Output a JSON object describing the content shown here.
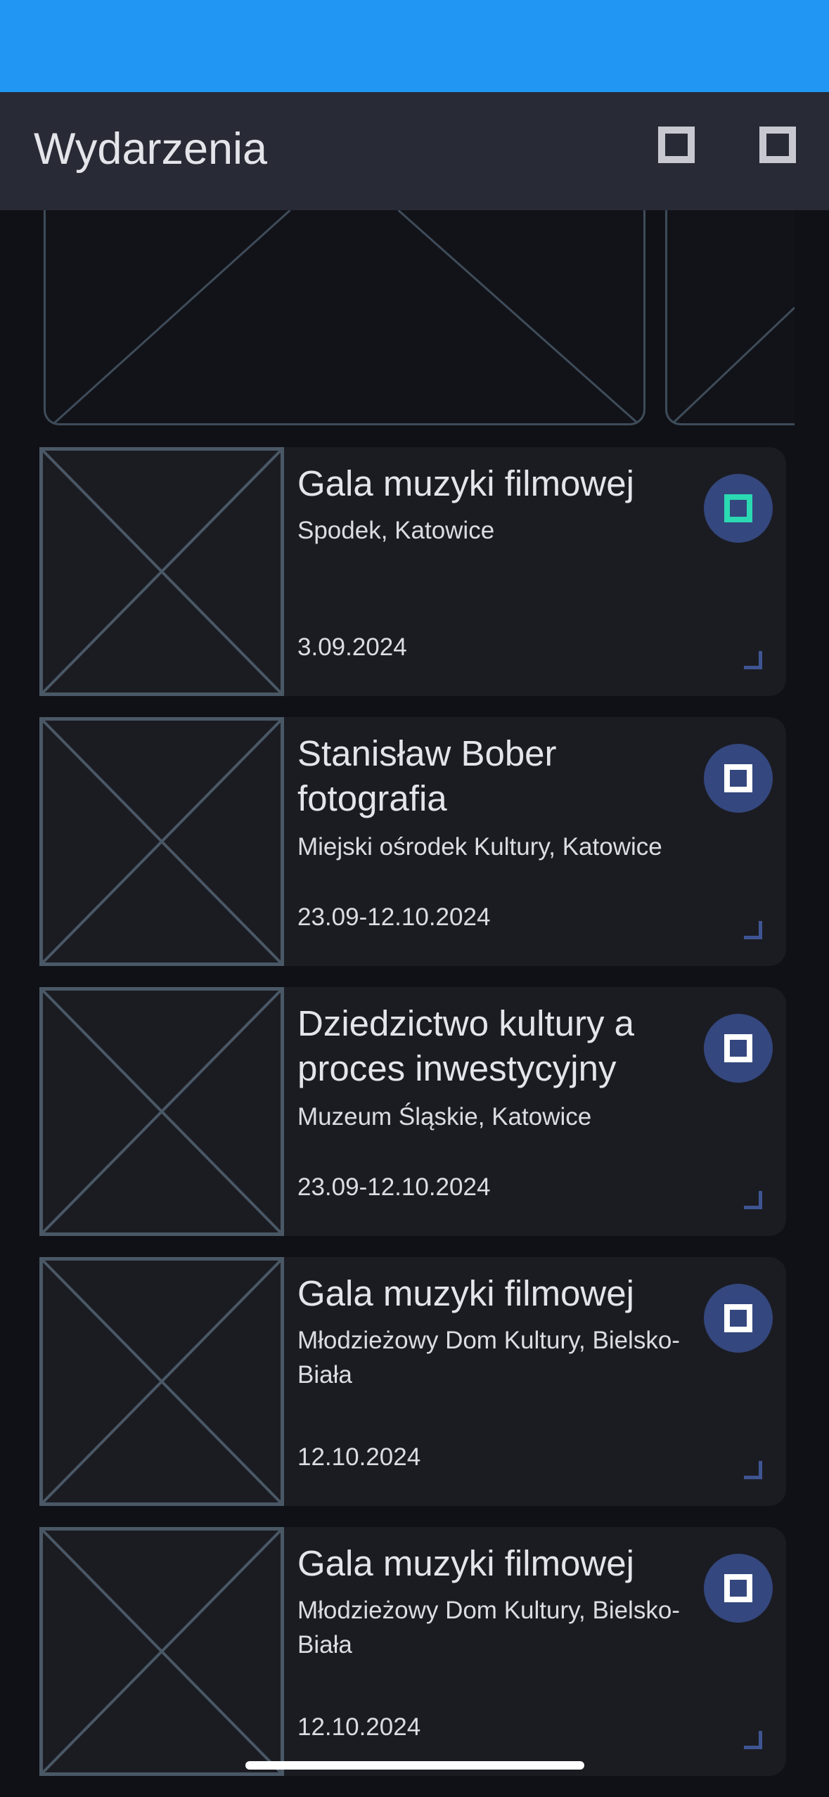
{
  "app_bar": {
    "title": "Wydarzenia",
    "icons": [
      "square-icon",
      "square-icon"
    ]
  },
  "events": [
    {
      "title": "Gala muzyki filmowej",
      "venue": "Spodek, Katowice",
      "date": "3.09.2024",
      "favorite_active": true
    },
    {
      "title": "Stanisław Bober fotografia",
      "venue": "Miejski ośrodek Kultury, Katowice",
      "date": "23.09-12.10.2024",
      "favorite_active": false
    },
    {
      "title": "Dziedzictwo kultury a proces inwestycyjny",
      "venue": "Muzeum Śląskie, Katowice",
      "date": "23.09-12.10.2024",
      "favorite_active": false
    },
    {
      "title": "Gala muzyki filmowej",
      "venue": "Młodzieżowy Dom Kultury, Bielsko-Biała",
      "date": "12.10.2024",
      "favorite_active": false
    },
    {
      "title": "Gala muzyki filmowej",
      "venue": "Młodzieżowy Dom Kultury, Bielsko-Biała",
      "date": "12.10.2024",
      "favorite_active": false
    }
  ],
  "colors": {
    "status_bar": "#2196F3",
    "app_bar": "#282a35",
    "background": "#101116",
    "card": "#1b1c22",
    "fav_button": "#34477e",
    "fav_active": "#2bd9b2"
  }
}
